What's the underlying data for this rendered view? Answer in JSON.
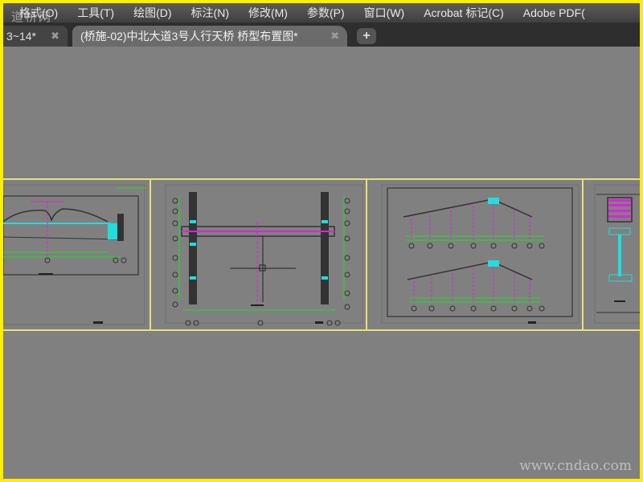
{
  "menubar": {
    "items": [
      "格式(O)",
      "工具(T)",
      "绘图(D)",
      "标注(N)",
      "修改(M)",
      "参数(P)",
      "窗口(W)",
      "Acrobat 标记(C)",
      "Adobe PDF("
    ]
  },
  "tabs": [
    {
      "label": "3~14*",
      "active": false
    },
    {
      "label": "(桥施-02)中北大道3号人行天桥 桥型布置图*",
      "active": true
    }
  ],
  "tab_close_icon": "close-icon",
  "add_tab_icon": "plus-icon",
  "watermarks": {
    "logo": "道桥网",
    "site": "www.cndao.com"
  },
  "colors": {
    "border": "#ffee00",
    "canvas": "#808080",
    "cad_green": "#22dd22",
    "cad_magenta": "#dd22dd",
    "cad_cyan": "#22dddd",
    "layout_border": "#e8e07a"
  }
}
